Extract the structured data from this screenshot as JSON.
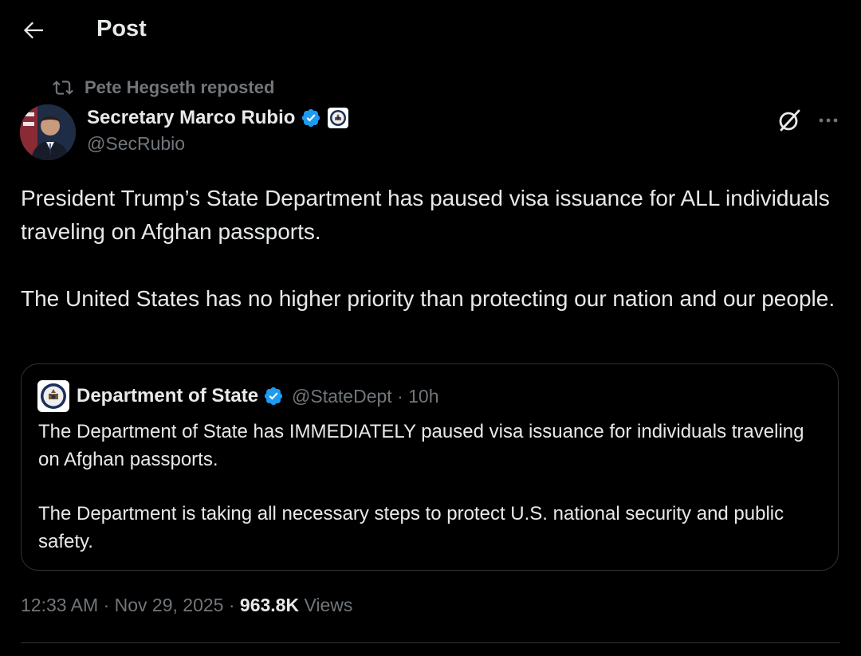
{
  "header": {
    "title": "Post"
  },
  "repost_banner": {
    "text": "Pete Hegseth reposted"
  },
  "author": {
    "name": "Secretary Marco Rubio",
    "handle": "@SecRubio"
  },
  "post": {
    "paragraphs": [
      "President Trump’s State Department has paused visa issuance for ALL individuals traveling on Afghan passports.",
      "The United States has no higher priority than protecting our nation and our people."
    ]
  },
  "quote": {
    "name": "Department of State",
    "handle": "@StateDept",
    "separator": "·",
    "time": "10h",
    "paragraphs": [
      "The Department of State has IMMEDIATELY paused visa issuance for individuals traveling on Afghan passports.",
      "The Department is taking all necessary steps to protect U.S. national security and public safety."
    ]
  },
  "meta": {
    "time": "12:33 AM",
    "separator": "·",
    "date": "Nov 29, 2025",
    "views_count": "963.8K",
    "views_label": "Views"
  },
  "colors": {
    "background": "#000000",
    "text_primary": "#e7e9ea",
    "text_secondary": "#71767b",
    "verified_blue": "#1d9bf0",
    "border": "#2f3336"
  },
  "icons": {
    "back": "arrow-left-icon",
    "repost": "repost-icon",
    "verified": "verified-badge-icon",
    "affiliation": "state-department-seal-icon",
    "grok": "grok-icon",
    "more": "more-options-icon"
  }
}
